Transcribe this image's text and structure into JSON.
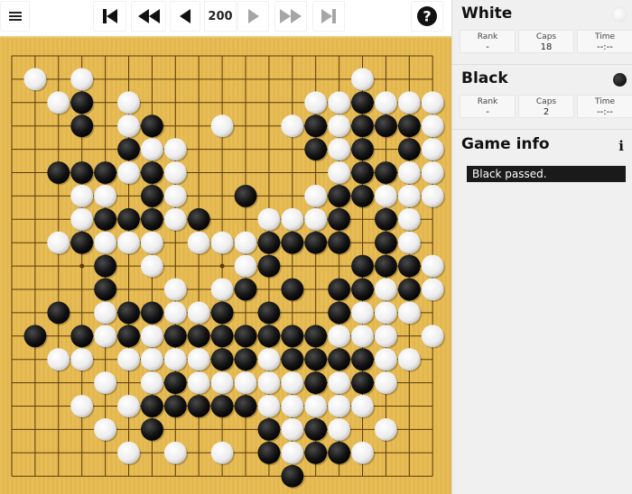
{
  "toolbar": {
    "menu_icon": "hamburger-menu-icon",
    "first_icon": "skip-to-first-icon",
    "fast_back_icon": "fast-backward-icon",
    "back_icon": "step-back-icon",
    "move_number": "200",
    "forward_icon": "step-forward-icon",
    "fast_forward_icon": "fast-forward-icon",
    "last_icon": "skip-to-last-icon",
    "help_icon": "help-question-icon",
    "colors": {
      "active": "#111111",
      "disabled": "#a6a6a6"
    }
  },
  "board": {
    "size": 19,
    "hoshi": [
      [
        3,
        3
      ],
      [
        3,
        9
      ],
      [
        3,
        15
      ],
      [
        9,
        3
      ],
      [
        9,
        9
      ],
      [
        9,
        15
      ],
      [
        15,
        3
      ],
      [
        15,
        9
      ],
      [
        15,
        15
      ]
    ],
    "colors": {
      "wood": "#e6b94e",
      "line": "#5a3a0a"
    },
    "rows": [
      "...................",
      ".W.W...........W...",
      "..WB.W.......WWBWWW",
      "...B.WB..W..WBWBBBW",
      ".....BWW.....BWB.BW",
      "..BBBWBW......WBBWW",
      "...WW.BW..B..WBBWWW",
      "...WBBBWB..WWWB.BW.",
      "..WBWWW.WWWBBBB.BW.",
      "....B.W...WB...BBBW",
      "....B..W.WB.B.BBWBW",
      "..B.WBBWWB.B..BWWW.",
      ".B.BWBWBBBBBBBWWW.W",
      "..WW.WWWWBBWBBBBWW.",
      "....W.WBWWWWWBWBW..",
      "...W.WBBBBBWWWWW...",
      "....W.B....BWBW.W..",
      ".....W.W.W.BWBBW...",
      "............B......"
    ]
  },
  "white": {
    "name": "White",
    "stone_icon": "white-stone-icon",
    "rank_label": "Rank",
    "rank": "-",
    "caps_label": "Caps",
    "caps": "18",
    "time_label": "Time",
    "time": "--:--"
  },
  "black": {
    "name": "Black",
    "stone_icon": "black-stone-icon",
    "rank_label": "Rank",
    "rank": "-",
    "caps_label": "Caps",
    "caps": "2",
    "time_label": "Time",
    "time": "--:--"
  },
  "game_info": {
    "title": "Game info",
    "info_icon": "i",
    "message": "Black passed."
  }
}
